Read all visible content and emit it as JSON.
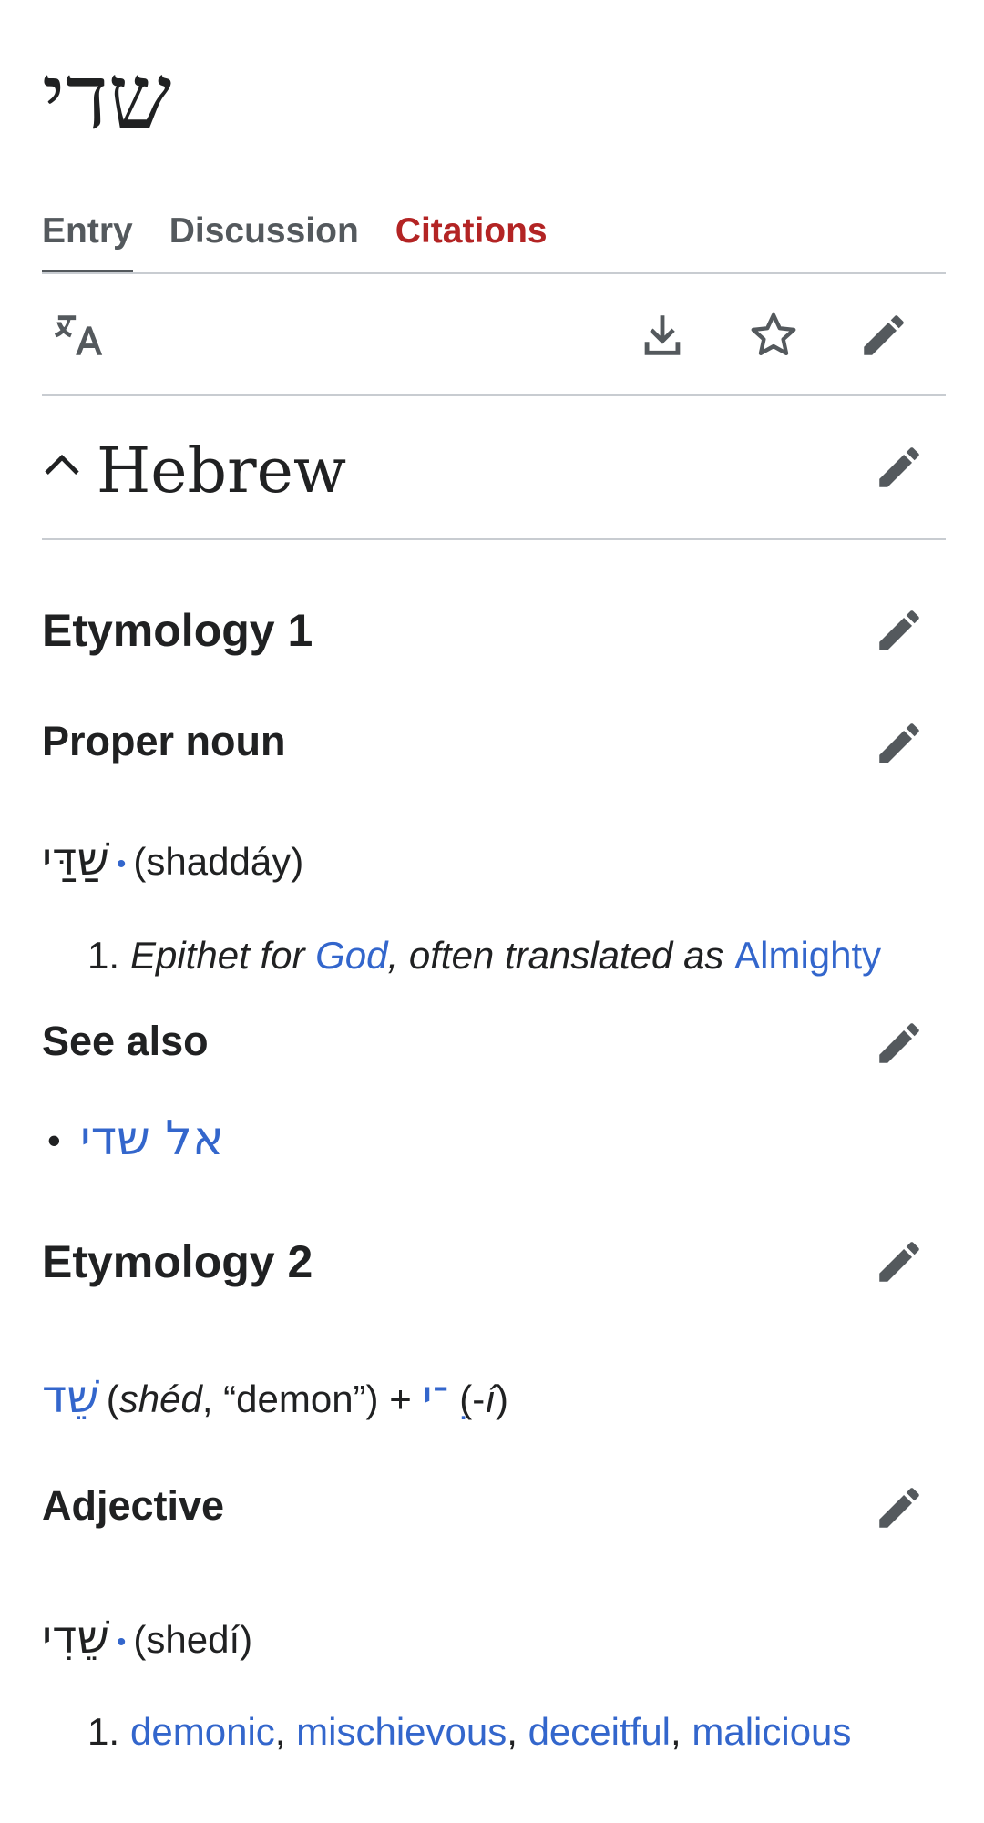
{
  "page": {
    "title": "שדי"
  },
  "tabs": [
    {
      "label": "Entry"
    },
    {
      "label": "Discussion"
    },
    {
      "label": "Citations"
    }
  ],
  "language": {
    "heading": "Hebrew"
  },
  "etymology1": {
    "heading": "Etymology 1",
    "pos": "Proper noun",
    "headword": "שַׁדַּי",
    "translit": "(shaddáy)",
    "def_number": "1.",
    "def_parts": [
      "Epithet for ",
      "God",
      ", often translated as ",
      "Almighty"
    ],
    "see_also_heading": "See also",
    "see_also_items": [
      "אל שדי"
    ]
  },
  "etymology2": {
    "heading": "Etymology 2",
    "ety_word1": "שֵׁד",
    "ety_open": "(",
    "ety_translit1": "shéd",
    "ety_gloss1": ", “demon”) + ",
    "ety_word2": "ִ־י",
    "ety_open2": " (-",
    "ety_translit2": "í",
    "ety_close2": ")",
    "pos": "Adjective",
    "headword": "שֵׁדִי",
    "translit": "(shedí)",
    "def_number": "1.",
    "def_links": [
      "demonic",
      "mischievous",
      "deceitful",
      "malicious"
    ],
    "sep": ", "
  },
  "icons": {
    "translate": "translate-icon",
    "download": "download-icon",
    "star": "star-icon",
    "edit": "pencil-icon",
    "collapse": "chevron-up-icon"
  },
  "colors": {
    "link": "#3366cc",
    "red_tab": "#b32424",
    "text": "#202122"
  }
}
